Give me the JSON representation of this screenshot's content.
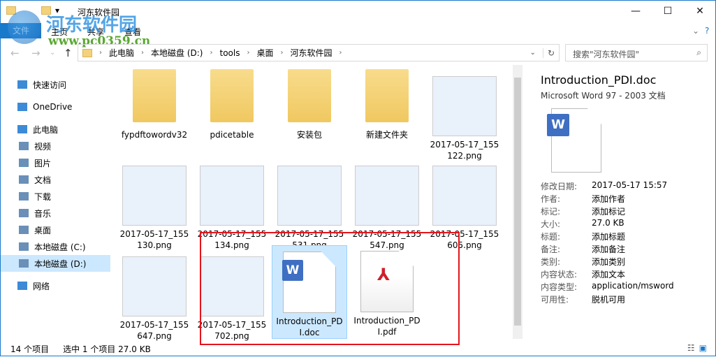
{
  "window": {
    "title": "河东软件园",
    "minimize": "—",
    "maximize": "☐",
    "close": "✕"
  },
  "watermark": {
    "name": "河东软件园",
    "url": "www.pc0359.cn"
  },
  "ribbon": {
    "tabs": [
      "文件",
      "主页",
      "共享",
      "查看"
    ]
  },
  "address": {
    "crumbs": [
      "此电脑",
      "本地磁盘 (D:)",
      "tools",
      "桌面",
      "河东软件园"
    ],
    "search_placeholder": "搜索\"河东软件园\""
  },
  "sidebar": [
    {
      "label": "快速访问",
      "icon": "star-icon",
      "group": true
    },
    {
      "label": "OneDrive",
      "icon": "cloud-icon",
      "group": true
    },
    {
      "label": "此电脑",
      "icon": "computer-icon",
      "group": true
    },
    {
      "label": "视频",
      "icon": "video-icon"
    },
    {
      "label": "图片",
      "icon": "picture-icon"
    },
    {
      "label": "文档",
      "icon": "document-icon"
    },
    {
      "label": "下载",
      "icon": "download-icon"
    },
    {
      "label": "音乐",
      "icon": "music-icon"
    },
    {
      "label": "桌面",
      "icon": "desktop-icon"
    },
    {
      "label": "本地磁盘 (C:)",
      "icon": "drive-icon"
    },
    {
      "label": "本地磁盘 (D:)",
      "icon": "drive-icon",
      "selected": true
    },
    {
      "label": "网络",
      "icon": "network-icon",
      "group": true
    }
  ],
  "files": [
    {
      "name": "fypdftowordv32",
      "type": "folder"
    },
    {
      "name": "pdicetable",
      "type": "folder"
    },
    {
      "name": "安装包",
      "type": "folder"
    },
    {
      "name": "新建文件夹",
      "type": "folder"
    },
    {
      "name": "2017-05-17_155122.png",
      "type": "image"
    },
    {
      "name": "2017-05-17_155130.png",
      "type": "image"
    },
    {
      "name": "2017-05-17_155134.png",
      "type": "image"
    },
    {
      "name": "2017-05-17_155531.png",
      "type": "image"
    },
    {
      "name": "2017-05-17_155547.png",
      "type": "image"
    },
    {
      "name": "2017-05-17_155605.png",
      "type": "image"
    },
    {
      "name": "2017-05-17_155647.png",
      "type": "image"
    },
    {
      "name": "2017-05-17_155702.png",
      "type": "image"
    },
    {
      "name": "Introduction_PDI.doc",
      "type": "doc",
      "selected": true
    },
    {
      "name": "Introduction_PDI.pdf",
      "type": "pdf"
    }
  ],
  "details": {
    "title": "Introduction_PDI.doc",
    "subtitle": "Microsoft Word 97 - 2003 文档",
    "props": [
      [
        "修改日期:",
        "2017-05-17 15:57"
      ],
      [
        "作者:",
        "添加作者"
      ],
      [
        "标记:",
        "添加标记"
      ],
      [
        "大小:",
        "27.0 KB"
      ],
      [
        "标题:",
        "添加标题"
      ],
      [
        "备注:",
        "添加备注"
      ],
      [
        "类别:",
        "添加类别"
      ],
      [
        "内容状态:",
        "添加文本"
      ],
      [
        "内容类型:",
        "application/msword"
      ],
      [
        "可用性:",
        "脱机可用"
      ]
    ]
  },
  "status": {
    "count": "14 个项目",
    "selected": "选中 1 个项目  27.0 KB"
  }
}
